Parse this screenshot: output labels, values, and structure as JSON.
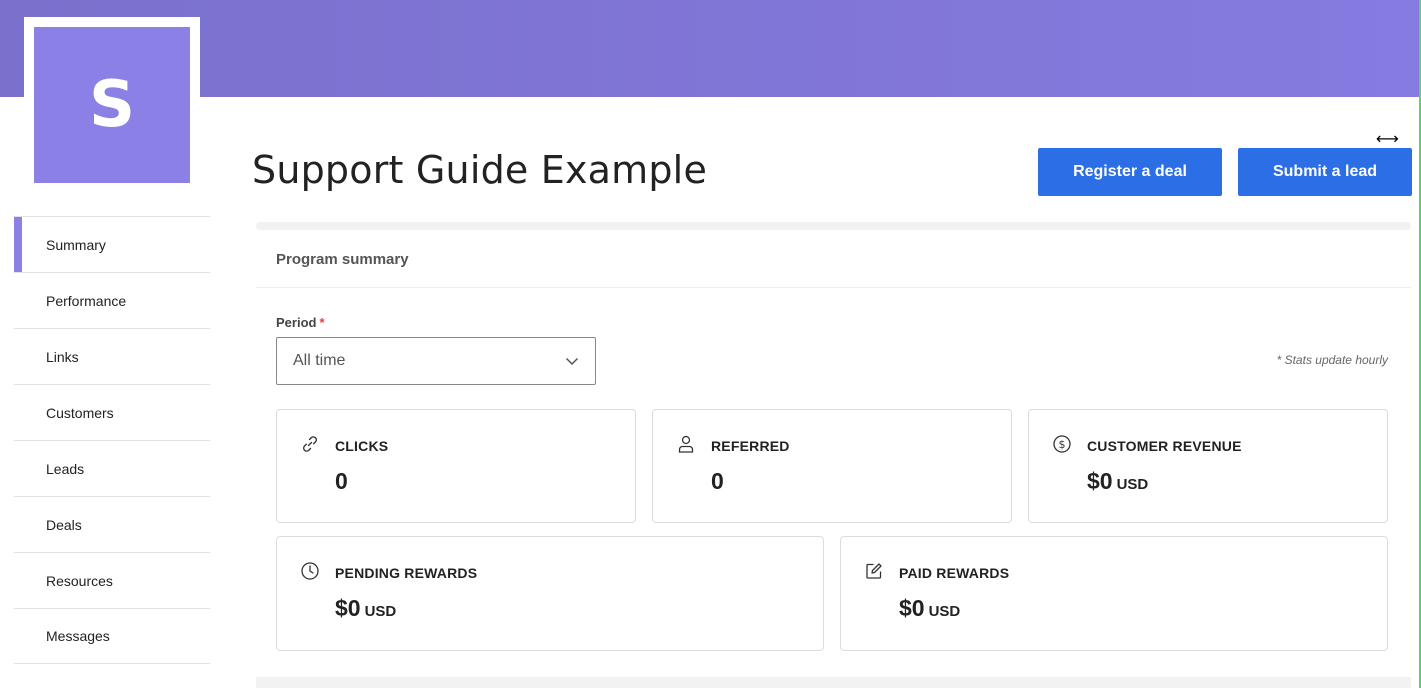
{
  "brand": {
    "logo_letter": "S",
    "accent_color": "#8a80e6",
    "banner_color": "#7f75d6"
  },
  "sidebar": {
    "items": [
      {
        "label": "Summary",
        "active": true
      },
      {
        "label": "Performance"
      },
      {
        "label": "Links"
      },
      {
        "label": "Customers"
      },
      {
        "label": "Leads"
      },
      {
        "label": "Deals"
      },
      {
        "label": "Resources"
      },
      {
        "label": "Messages"
      }
    ]
  },
  "header": {
    "title": "Support Guide Example",
    "register_deal_label": "Register a deal",
    "submit_lead_label": "Submit a lead",
    "button_color": "#2b6ee6"
  },
  "summary": {
    "section_title": "Program summary",
    "period_label": "Period",
    "period_required_mark": "*",
    "period_value": "All time",
    "stats_note": "* Stats update hourly",
    "stats": {
      "clicks": {
        "label": "CLICKS",
        "value": "0",
        "icon": "link-icon"
      },
      "referred": {
        "label": "REFERRED",
        "value": "0",
        "icon": "user-icon"
      },
      "customer_revenue": {
        "label": "CUSTOMER REVENUE",
        "value": "$0",
        "unit": "USD",
        "icon": "dollar-circle-icon"
      },
      "pending_rewards": {
        "label": "PENDING REWARDS",
        "value": "$0",
        "unit": "USD",
        "icon": "clock-icon"
      },
      "paid_rewards": {
        "label": "PAID REWARDS",
        "value": "$0",
        "unit": "USD",
        "icon": "edit-icon"
      }
    }
  }
}
